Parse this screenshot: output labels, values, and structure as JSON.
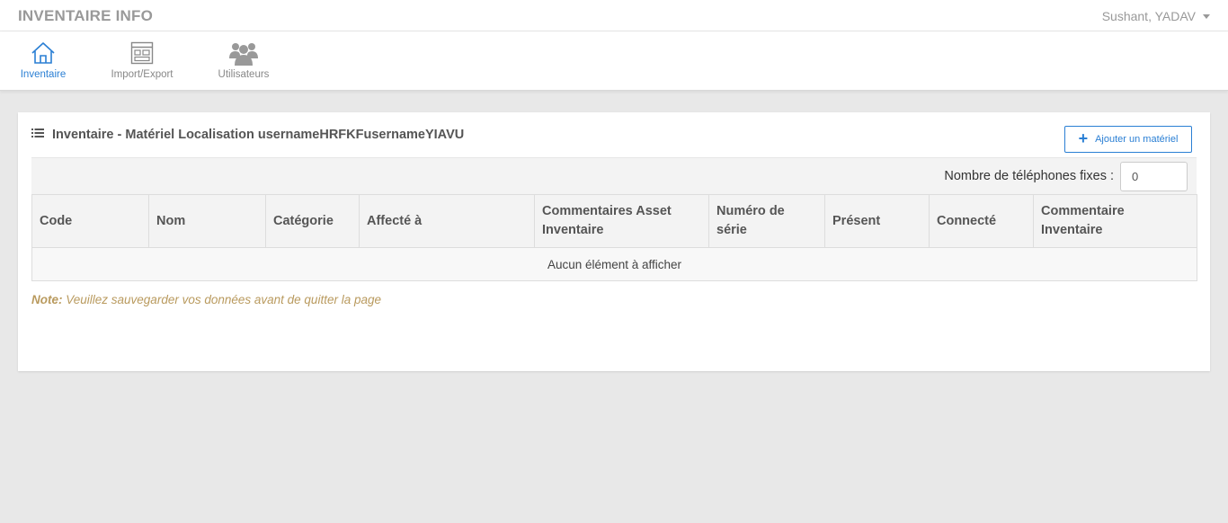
{
  "app": {
    "title": "INVENTAIRE INFO",
    "user": "Sushant, YADAV"
  },
  "nav": [
    {
      "label": "Inventaire",
      "icon": "home-icon",
      "active": true
    },
    {
      "label": "Import/Export",
      "icon": "import-export-icon",
      "active": false
    },
    {
      "label": "Utilisateurs",
      "icon": "users-icon",
      "active": false
    }
  ],
  "panel": {
    "title": "Inventaire - Matériel Localisation usernameHRFKFusernameYIAVU",
    "add_button": "Ajouter un matériel",
    "filter_label": "Nombre de téléphones fixes :",
    "filter_value": "0"
  },
  "table": {
    "columns": [
      "Code",
      "Nom",
      "Catégorie",
      "Affecté à",
      "Commentaires Asset Inventaire",
      "Numéro de série",
      "Présent",
      "Connecté",
      "Commentaire Inventaire"
    ],
    "empty_message": "Aucun élément à afficher"
  },
  "note": {
    "label": "Note:",
    "text": " Veuillez sauvegarder vos données avant de quitter la page"
  },
  "colors": {
    "accent": "#2a7fd4",
    "note": "#b99a5e",
    "muted": "#999999"
  }
}
